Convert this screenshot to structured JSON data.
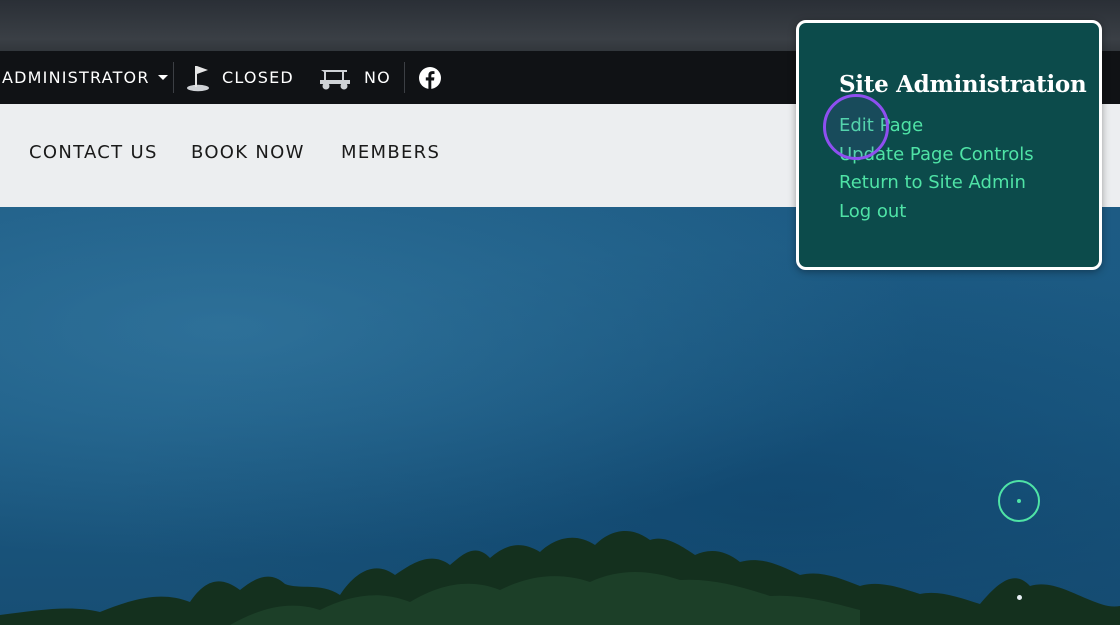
{
  "topbar": {
    "admin_label": "ADMINISTRATOR",
    "course_status": "CLOSED",
    "carts_status": "NO",
    "icons": [
      "flag-icon",
      "golf-cart-icon",
      "facebook-icon",
      "chevron-down-icon"
    ]
  },
  "nav": {
    "items": [
      {
        "label": "CONTACT US"
      },
      {
        "label": "BOOK NOW"
      },
      {
        "label": "MEMBERS"
      }
    ]
  },
  "admin_panel": {
    "title": "Site Administration",
    "links": [
      {
        "label": "Edit Page"
      },
      {
        "label": "Update Page Controls"
      },
      {
        "label": "Return to Site Admin"
      },
      {
        "label": "Log out"
      }
    ]
  },
  "colors": {
    "topbar_bg": "#101215",
    "nav_bg": "#eceef0",
    "panel_bg": "#0c4b4b",
    "link_accent": "#4fe3a6",
    "click_ring": "#8e4ff0"
  }
}
